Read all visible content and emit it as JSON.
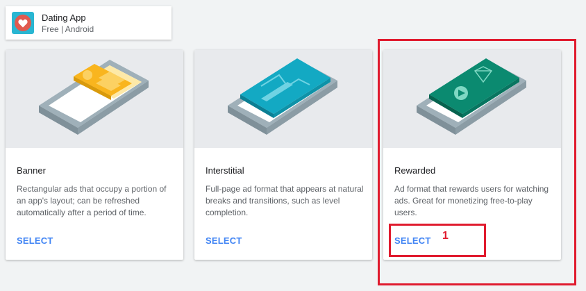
{
  "app": {
    "name": "Dating App",
    "meta": "Free | Android"
  },
  "formats": [
    {
      "title": "Banner",
      "description": "Rectangular ads that occupy a portion of an app's layout; can be refreshed automatically after a period of time.",
      "action": "SELECT",
      "accent": "#f9b51e"
    },
    {
      "title": "Interstitial",
      "description": "Full-page ad format that appears at natural breaks and transitions, such as level completion.",
      "action": "SELECT",
      "accent": "#13a9c3"
    },
    {
      "title": "Rewarded",
      "description": "Ad format that rewards users for watching ads. Great for monetizing free-to-play users.",
      "action": "SELECT",
      "accent": "#0b8a70"
    }
  ],
  "annotation": {
    "number": "1",
    "color": "#e01b2e"
  },
  "colors": {
    "link": "#4285f4",
    "background": "#f1f3f4",
    "illustration_bg": "#e8eaed"
  }
}
